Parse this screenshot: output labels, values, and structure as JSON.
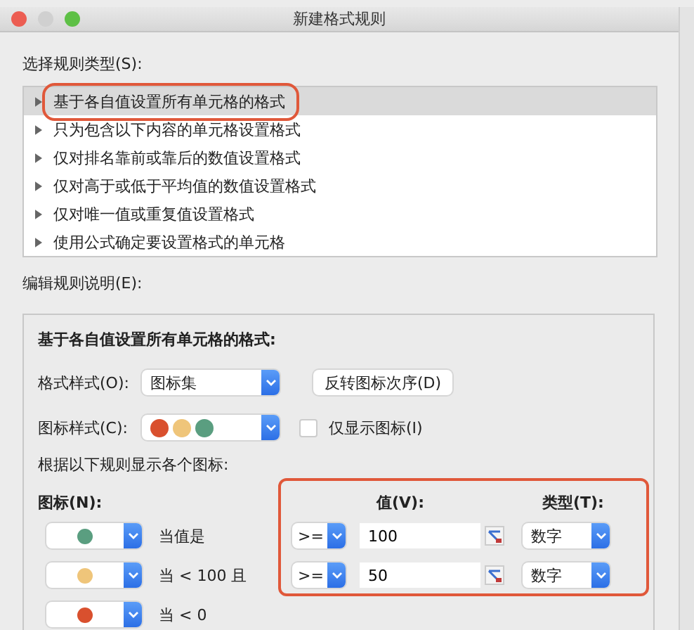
{
  "window": {
    "title": "新建格式规则"
  },
  "rule_type_label": "选择规则类型(S):",
  "rule_types": [
    {
      "label": "基于各自值设置所有单元格的格式",
      "selected": true,
      "highlighted": true
    },
    {
      "label": "只为包含以下内容的单元格设置格式",
      "selected": false,
      "highlighted": false
    },
    {
      "label": "仅对排名靠前或靠后的数值设置格式",
      "selected": false,
      "highlighted": false
    },
    {
      "label": "仅对高于或低于平均值的数值设置格式",
      "selected": false,
      "highlighted": false
    },
    {
      "label": "仅对唯一值或重复值设置格式",
      "selected": false,
      "highlighted": false
    },
    {
      "label": "使用公式确定要设置格式的单元格",
      "selected": false,
      "highlighted": false
    }
  ],
  "edit_label": "编辑规则说明(E):",
  "description": {
    "heading": "基于各自值设置所有单元格的格式:",
    "format_style": {
      "label": "格式样式(O):",
      "value": "图标集"
    },
    "reverse_button": "反转图标次序(D)",
    "icon_style": {
      "label": "图标样式(C):",
      "icons": [
        {
          "color": "#d9502e"
        },
        {
          "color": "#efc57a"
        },
        {
          "color": "#5a9e80"
        }
      ]
    },
    "show_icon_only": {
      "label": "仅显示图标(I)",
      "checked": false
    },
    "rules_label": "根据以下规则显示各个图标:",
    "icon_header": "图标(N):",
    "value_header": "值(V):",
    "type_header": "类型(T):",
    "criteria_highlighted": true,
    "icon_rows": [
      {
        "color": "#5a9e80",
        "condition": "当值是"
      },
      {
        "color": "#efc57a",
        "condition": "当 < 100 且"
      },
      {
        "color": "#d9502e",
        "condition": "当 < 0"
      }
    ],
    "criteria": [
      {
        "operator": ">=",
        "value": "100",
        "type": "数字"
      },
      {
        "operator": ">=",
        "value": "50",
        "type": "数字"
      }
    ]
  }
}
